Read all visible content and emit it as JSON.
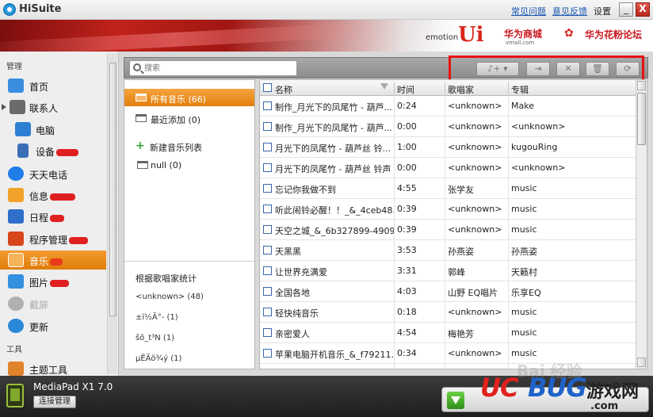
{
  "window": {
    "title": "HiSuite",
    "links": {
      "faq": "常见问题",
      "feedback": "意见反馈"
    },
    "settings": "设置",
    "minimize": "_",
    "close": "X"
  },
  "banner": {
    "emotion_text": "emotion",
    "ui_text": "Ui",
    "vmall": "华为商城",
    "vmall_sub": "vmall.com",
    "forum": "华为花粉论坛",
    "forum_logo": "✿"
  },
  "sidebar": {
    "section_manage": "管理",
    "section_tools": "工具",
    "items": [
      {
        "label": "首页",
        "icon": "home-icon",
        "color": "#3a8ee0"
      },
      {
        "label": "联系人",
        "icon": "contacts-icon",
        "color": "#6b6b6b"
      },
      {
        "label": "电脑",
        "icon": "computer-icon",
        "color": "#2d7fd4"
      },
      {
        "label": "设备",
        "icon": "phone-icon",
        "color": "#3a6fb8"
      },
      {
        "label": "天天电话",
        "icon": "call-icon",
        "color": "#1f7ee8"
      },
      {
        "label": "信息",
        "icon": "message-icon",
        "color": "#f0a22a"
      },
      {
        "label": "日程",
        "icon": "calendar-icon",
        "color": "#2f6fc9"
      },
      {
        "label": "程序管理",
        "icon": "apps-icon",
        "color": "#d8451b"
      },
      {
        "label": "音乐",
        "icon": "music-icon",
        "color": "#f6b45a"
      },
      {
        "label": "图片",
        "icon": "picture-icon",
        "color": "#3391e0"
      },
      {
        "label": "截屏",
        "icon": "screenshot-icon",
        "color": "#b0b0b0"
      },
      {
        "label": "更新",
        "icon": "update-icon",
        "color": "#2a88d8"
      },
      {
        "label": "主题工具",
        "icon": "theme-icon",
        "color": "#e0832a"
      }
    ]
  },
  "search": {
    "placeholder": "搜索"
  },
  "toolbar": {
    "import_label": "♪+ ▾",
    "export_label": "⇥",
    "delete_label": "✕",
    "trash_label": "🗑",
    "refresh_label": "⟳"
  },
  "playlists": {
    "all_music": "所有音乐 (66)",
    "recent": "最近添加 (0)",
    "new_playlist": "新建音乐列表",
    "null_list": "null (0)",
    "stats_title": "根据歌唱家统计",
    "artists": [
      "<unknown> (48)",
      "±ï½Ã°- (1)",
      "šõ_t³N (1)",
      "µËÃö¾ý (1)"
    ]
  },
  "table": {
    "headers": {
      "name": "名称",
      "time": "时间",
      "artist": "歌唱家",
      "album": "专辑"
    },
    "rows": [
      {
        "name": "制作_月光下的凤尾竹 - 葫芦...",
        "time": "0:24",
        "artist": "<unknown>",
        "album": "Make"
      },
      {
        "name": "制作_月光下的凤尾竹 - 葫芦...",
        "time": "0:00",
        "artist": "<unknown>",
        "album": "<unknown>"
      },
      {
        "name": "月光下的凤尾竹 - 葫芦丝 铃...",
        "time": "1:00",
        "artist": "<unknown>",
        "album": "kugouRing"
      },
      {
        "name": "月光下的凤尾竹 - 葫芦丝 铃声",
        "time": "0:00",
        "artist": "<unknown>",
        "album": "<unknown>"
      },
      {
        "name": "忘记你我做不到",
        "time": "4:55",
        "artist": "张学友",
        "album": "music"
      },
      {
        "name": "听此闹铃必醒！！_&_4ceb48...",
        "time": "0:39",
        "artist": "<unknown>",
        "album": "music"
      },
      {
        "name": "天空之城_&_6b327899-4909...",
        "time": "0:39",
        "artist": "<unknown>",
        "album": "music"
      },
      {
        "name": "天黑黑",
        "time": "3:53",
        "artist": "孙燕姿",
        "album": "孙燕姿"
      },
      {
        "name": "让世界充满爱",
        "time": "3:31",
        "artist": "郭峰",
        "album": "天籁村"
      },
      {
        "name": "全国各地",
        "time": "4:03",
        "artist": "山野 EQ唱片",
        "album": "乐享EQ"
      },
      {
        "name": "轻快纯音乐",
        "time": "0:18",
        "artist": "<unknown>",
        "album": "music"
      },
      {
        "name": "亲密爱人",
        "time": "4:54",
        "artist": "梅艳芳",
        "album": "music"
      },
      {
        "name": "苹果电脑开机音乐_&_f79211...",
        "time": "0:34",
        "artist": "<unknown>",
        "album": "music"
      }
    ]
  },
  "device": {
    "name": "MediaPad X1 7.0",
    "connect_label": "连接管理"
  },
  "watermark": {
    "uc": "UC",
    "bug": "BUG",
    "game": "游戏网",
    "com": ".com",
    "baidu": "Bai 经验"
  },
  "colors": {
    "accent": "#e88a16",
    "banner_red": "#c0221b",
    "highlight": "#e81010"
  }
}
